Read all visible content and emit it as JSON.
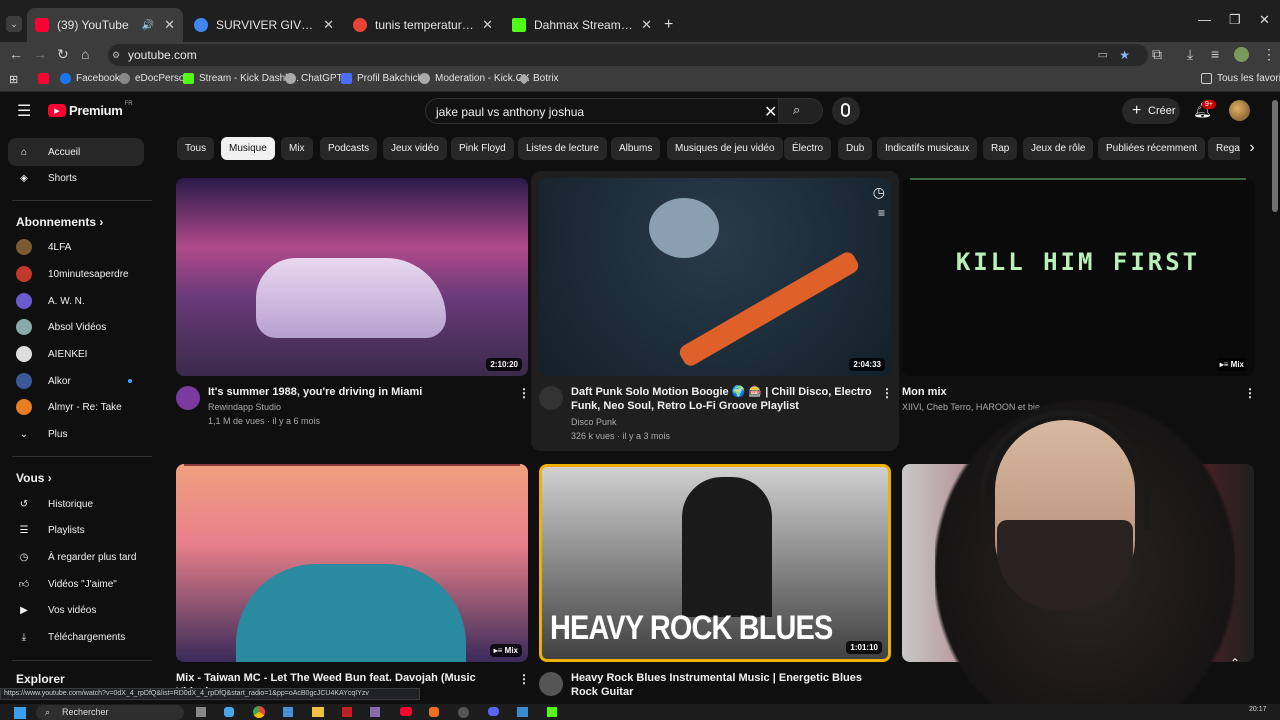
{
  "tabs": [
    {
      "label": "(39) YouTube",
      "favicon": "#ff0033"
    },
    {
      "label": "SURVIVER GIVEAWAY",
      "favicon": "#4285f4"
    },
    {
      "label": "tunis temperature demain - Re",
      "favicon": "#ea4335"
    },
    {
      "label": "Dahmax Stream - Watch Live o",
      "favicon": "#53fc18"
    }
  ],
  "address": {
    "url": "youtube.com"
  },
  "bookmarks": [
    {
      "label": "",
      "color": "#ff0033"
    },
    {
      "label": "Facebook",
      "color": "#1877f2"
    },
    {
      "label": "eDocPerso",
      "color": "#888"
    },
    {
      "label": "Stream - Kick Dashb...",
      "color": "#53fc18"
    },
    {
      "label": "ChatGPT",
      "color": "#aaa"
    },
    {
      "label": "Profil Bakchich",
      "color": "#4a6cf7"
    },
    {
      "label": "Moderation - Kick.CX",
      "color": "#aaa"
    },
    {
      "label": "Botrix",
      "color": "#aaa"
    }
  ],
  "bookmarks_right": "Tous les favoris",
  "header": {
    "logo": "Premium",
    "logo_region": "FR",
    "search_query": "jake paul vs anthony joshua",
    "create_label": "Créer",
    "notif_count": "9+"
  },
  "sidebar": {
    "main": [
      {
        "label": "Accueil",
        "icon": "home-icon"
      },
      {
        "label": "Shorts",
        "icon": "shorts-icon"
      }
    ],
    "subs_header": "Abonnements",
    "subs": [
      {
        "label": "4LFA",
        "color": "#7c5a2f"
      },
      {
        "label": "10minutesaperdre",
        "color": "#c0392b"
      },
      {
        "label": "A. W. N.",
        "color": "#6a5acd"
      },
      {
        "label": "Absol Vidéos",
        "color": "#8aa"
      },
      {
        "label": "AIENKEI",
        "color": "#ddd"
      },
      {
        "label": "Alkor",
        "color": "#3b5998"
      },
      {
        "label": "Almyr - Re: Take",
        "color": "#e67e22"
      }
    ],
    "more_label": "Plus",
    "you_header": "Vous",
    "you": [
      {
        "label": "Historique",
        "icon": "history-icon"
      },
      {
        "label": "Playlists",
        "icon": "playlist-icon"
      },
      {
        "label": "À regarder plus tard",
        "icon": "clock-icon"
      },
      {
        "label": "Vidéos \"J'aime\"",
        "icon": "like-icon"
      },
      {
        "label": "Vos vidéos",
        "icon": "video-icon"
      },
      {
        "label": "Téléchargements",
        "icon": "download-icon"
      }
    ],
    "explore_header": "Explorer"
  },
  "chips": [
    "Tous",
    "Musique",
    "Mix",
    "Podcasts",
    "Jeux vidéo",
    "Pink Floyd",
    "Listes de lecture",
    "Albums",
    "Musiques de jeu vidéo",
    "Électro",
    "Dub",
    "Indicatifs musicaux",
    "Rap",
    "Jeux de rôle",
    "Publiées récemment",
    "Regar"
  ],
  "videos": [
    {
      "title": "It's summer 1988, you're driving in Miami",
      "channel": "Rewindapp Studio",
      "stats": "1,1 M de vues · il y a 6 mois",
      "duration": "2:10:20"
    },
    {
      "title": "Daft Punk Solo Motion Boogie 🌍 🎰 | Chill Disco, Electro Funk, Neo Soul, Retro Lo-Fi Groove Playlist",
      "channel": "Disco Punk",
      "stats": "326 k vues · il y a 3 mois",
      "duration": "2:04:33"
    },
    {
      "title": "Mon mix",
      "channel": "XIIVI, Cheb Terro, HAROON et bie...",
      "stats": "",
      "duration": "Mix",
      "overlay_text": "KILL HIM FIRST"
    },
    {
      "title": "Mix - Taiwan MC - Let The Weed Bun feat. Davojah (Music Video)",
      "channel": "",
      "stats": "",
      "duration": "Mix"
    },
    {
      "title": "Heavy Rock Blues Instrumental Music | Energetic Blues Rock Guitar",
      "channel": "",
      "stats": "",
      "duration": "1:01:10",
      "overlay_text": "HEAVY ROCK BLUES"
    }
  ],
  "status_url": "https://www.youtube.com/watch?v=0dX_4_rpDfQ&list=RD0dX_4_rpDfQ&start_radio=1&pp=oAcB0gcJCU4KAYcqIYzv",
  "taskbar": {
    "search_placeholder": "Rechercher",
    "time": "20:17"
  }
}
